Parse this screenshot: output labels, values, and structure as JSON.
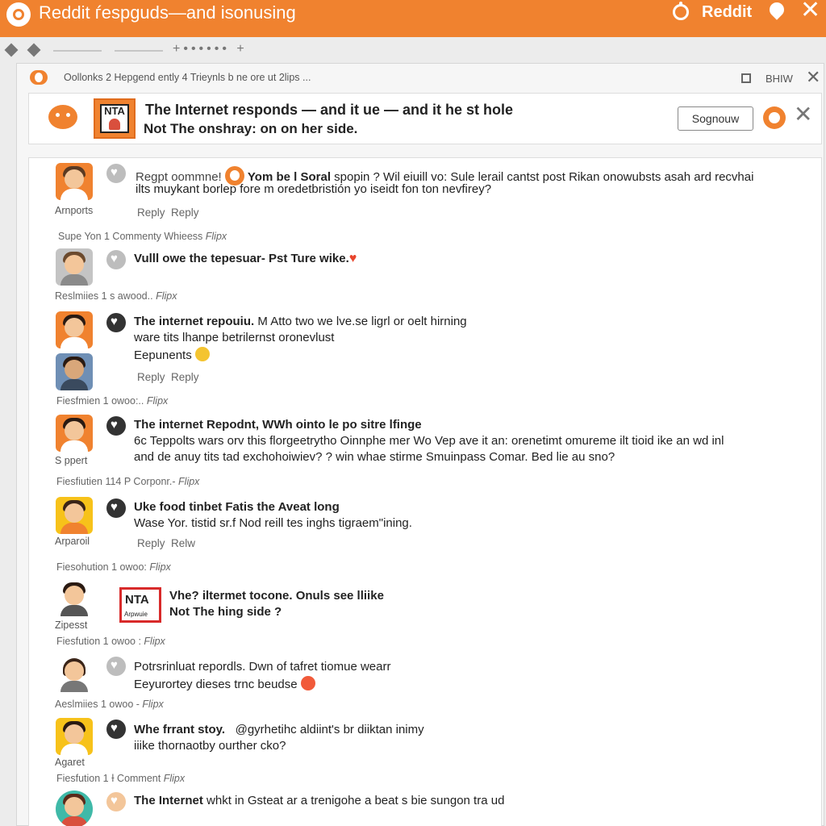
{
  "topbar": {
    "title": "Reddit ѓespguds—and isonusing",
    "brand": "Reddit"
  },
  "infobar": {
    "text": "Oollonks 2 Hepgend ently 4 Trieynls b ne ore ut 2lips ...",
    "label": "BHIW"
  },
  "post": {
    "badge": "NTA",
    "title": "The Internet responds — and it ue — and it he st hole",
    "subtitle": "Not The onshray: on on her side.",
    "signup_label": "Sognouw"
  },
  "comments": [
    {
      "user": "Arnports",
      "line1_a": "Regpt oommne!",
      "line1_b": "Yom be l Soral",
      "line1_c": "spopin ? Wil eiuill vo: Sule lerail cantst post Rikan onowubsts asah ard recvhai",
      "line2": "ilts muykant borlep fore m oredetbristión yo iseidt fon ton nevfirey?",
      "reply1": "Reply",
      "reply2": "Reply",
      "meta": "Supe Yon 1 Commenty Whieess",
      "meta_tag": "Flipx"
    },
    {
      "user": "Reslmiies 1 s awood..",
      "line1": "Vulll owe the tepesuar- Pst Ture wike.",
      "meta_tag": "Flipx"
    },
    {
      "line1_a": "The internet repouiu.",
      "line1_b": "M Atto two we lve.se ligrl or oelt hirning",
      "line2": "ware tits lhanpe betrilernst oronevlust",
      "line3": "Eepunents",
      "reply1": "Reply",
      "reply2": "Reply",
      "meta": "Fiesfmien 1 owoo:..",
      "meta_tag": "Flipx"
    },
    {
      "user": "S ppert",
      "line1": "The internet Repodnt, WWh ointo le po sitre lfinge",
      "line2": "6c Teppolts wars orv this florgeetrytho Oinnphe mer Wo Vep ave it an: orenetimt omureme ilt tioid ike an wd inl",
      "line3": "and de anuy tits tad exchohoiwiev? ? win whae stirme Smuinpass Comar. Bed lie au sno?",
      "meta": "Fiesfiutien 114 P Corponr.-",
      "meta_tag": "Flipx"
    },
    {
      "user": "Arparoil",
      "line1": "Uke food tinbet Fatis the Aveat long",
      "line2": "Wase Yor. tistid sr.f Nod reill tes inghs tigraem\"ining.",
      "reply1": "Reply",
      "reply2": "Relw",
      "meta": "Fiesohution 1 owoo:",
      "meta_tag": "Flipx"
    },
    {
      "user": "Zipesst",
      "badge": "NTA",
      "badge_sub": "Arpwuie",
      "line1": "Vhe? iltermet tocone. Onuls see lliike",
      "line2": "Not The hing side ?",
      "meta": "Fiesfution 1 owoo :",
      "meta_tag": "Flipx"
    },
    {
      "user": "Aeslmiies 1 owoo -",
      "line1": "Potrsrinluat repordls. Dwn of tafret tiomue wearr",
      "line2": "Eeyurortey dieses trnc beudse",
      "meta_tag": "Flipx"
    },
    {
      "user": "Agaret",
      "line1_a": "Whe frrant stoy.",
      "line1_b": "@gyrhetihc aldiint's br diiktan inimy",
      "line2": "iiike thornaotby ourther cko?",
      "meta": "Fiesfution 1 Ɨ Comment",
      "meta_tag": "Flipx"
    },
    {
      "line1_a": "The Internet",
      "line1_b": "whkt in Gsteat ar a trenigohe a beat s bie sungon tra ud"
    }
  ],
  "colors": {
    "brand_orange": "#f0822f",
    "accent_red": "#d82a2a"
  },
  "icons": {
    "app_logo": "reddit-ring-icon",
    "pin": "location-pin-icon",
    "close": "close-icon",
    "like": "heart-icon"
  }
}
